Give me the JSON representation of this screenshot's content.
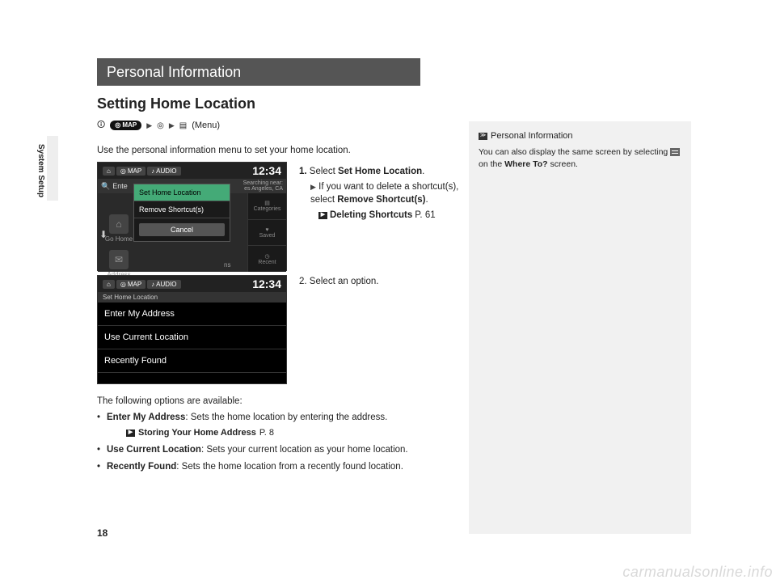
{
  "side_tab": "System Setup",
  "chapter": "Personal Information",
  "section": "Setting Home Location",
  "breadcrumb": {
    "map_label": "MAP",
    "menu_label": "(Menu)"
  },
  "intro": "Use the personal information menu to set your home location.",
  "screen1": {
    "status": {
      "map": "MAP",
      "audio": "AUDIO",
      "clock": "12:34"
    },
    "search_placeholder": "Ente",
    "near_label": "Searching near:",
    "near_value": "es Angeles, CA",
    "tiles": {
      "gohome": "Go Home",
      "address": "Address",
      "trailing": "ns"
    },
    "rightcol": {
      "categories": "Categories",
      "saved": "Saved",
      "recent": "Recent"
    },
    "modal": {
      "item1": "Set Home Location",
      "item2": "Remove Shortcut(s)",
      "cancel": "Cancel"
    }
  },
  "screen2": {
    "status": {
      "map": "MAP",
      "audio": "AUDIO",
      "clock": "12:34"
    },
    "header": "Set Home Location",
    "rows": [
      "Enter My Address",
      "Use Current Location",
      "Recently Found"
    ]
  },
  "steps": {
    "s1_num": "1.",
    "s1_a": "Select ",
    "s1_bold": "Set Home Location",
    "s1_b": ".",
    "s1_sub_a": "If you want to delete a shortcut(s), select ",
    "s1_sub_bold": "Remove Shortcut(s)",
    "s1_sub_b": ".",
    "s1_ref": "Deleting Shortcuts",
    "s1_refpage": "P. 61",
    "s2_num": "2.",
    "s2_text": "Select an option."
  },
  "options": {
    "intro": "The following options are available:",
    "items": [
      {
        "bold": "Enter My Address",
        "text": ": Sets the home location by entering the address.",
        "ref": "Storing Your Home Address",
        "refpage": "P. 8"
      },
      {
        "bold": "Use Current Location",
        "text": ": Sets your current location as your home location."
      },
      {
        "bold": "Recently Found",
        "text": ": Sets the home location from a recently found location."
      }
    ]
  },
  "sidebox": {
    "title": "Personal Information",
    "body_a": "You can also display the same screen by selecting ",
    "body_b": " on the ",
    "body_bold": "Where To?",
    "body_c": " screen."
  },
  "pagenum": "18",
  "watermark": "carmanualsonline.info"
}
